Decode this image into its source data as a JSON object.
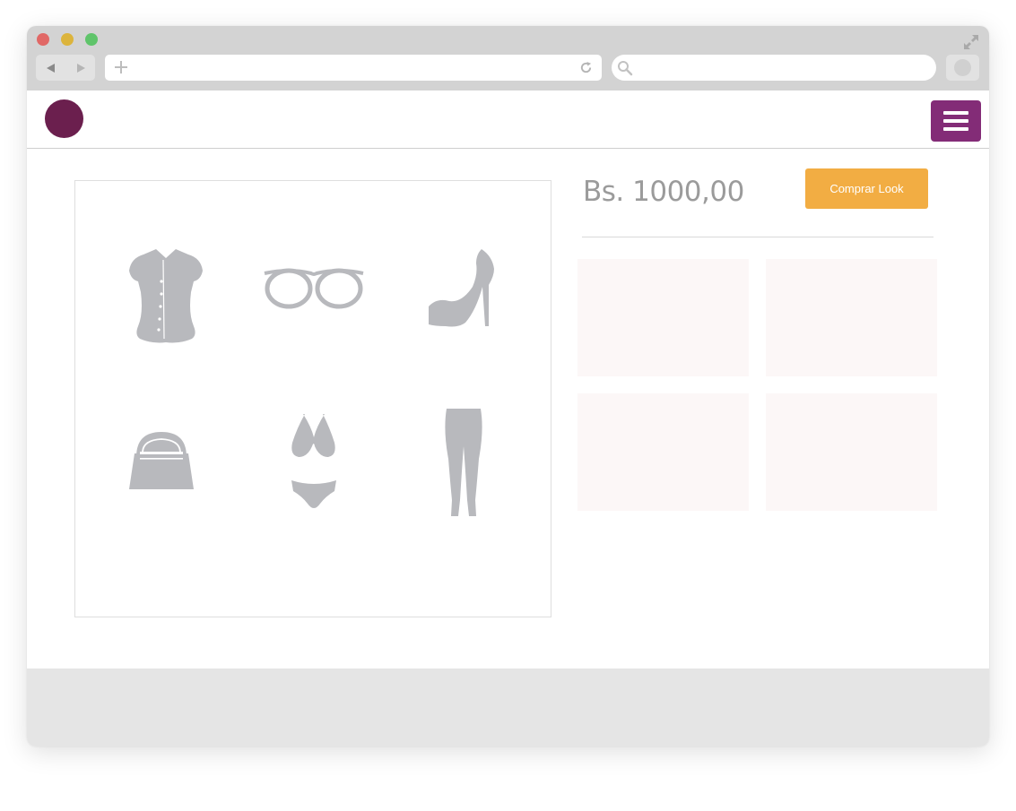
{
  "browser": {
    "traffic_lights": [
      "close",
      "minimize",
      "zoom"
    ],
    "url_value": "",
    "search_value": ""
  },
  "header": {
    "logo_color": "#6b1f4e",
    "menu_color": "#832c77"
  },
  "look": {
    "items": [
      {
        "icon": "blouse-icon"
      },
      {
        "icon": "glasses-icon"
      },
      {
        "icon": "high-heel-icon"
      },
      {
        "icon": "handbag-icon"
      },
      {
        "icon": "bikini-icon"
      },
      {
        "icon": "leggings-icon"
      }
    ],
    "item_color": "#b8b9bd"
  },
  "product": {
    "price": "Bs. 1000,00",
    "buy_label": "Comprar Look",
    "buy_color": "#f2ad43"
  }
}
